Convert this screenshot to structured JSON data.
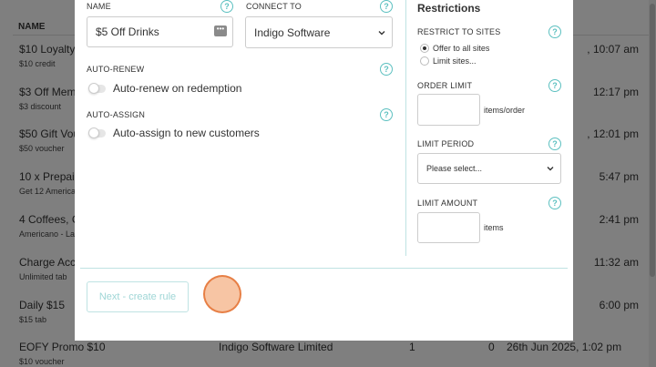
{
  "background": {
    "header_name": "NAME",
    "rows": [
      {
        "title": "$10 Loyalty",
        "sub": "$10 credit",
        "col_date": ", 10:07 am"
      },
      {
        "title": "$3 Off Mem",
        "sub": "$3 discount",
        "col_date": "12:17 pm"
      },
      {
        "title": "$50 Gift Vou",
        "sub": "$50 voucher",
        "col_date": ", 12:01 pm"
      },
      {
        "title": "10 x Prepaid",
        "sub": "Get 12 America",
        "col_date": "5:47 pm"
      },
      {
        "title": "4 Coffees, G",
        "sub": "Americano - La",
        "col_date": "2:41 pm"
      },
      {
        "title": "Charge Acco",
        "sub": "Unlimited tab",
        "col_date": "11:32 am"
      },
      {
        "title": "Daily $15",
        "sub": "$15 tab",
        "col_date": "6:00 pm"
      },
      {
        "title": "EOFY Promo $10",
        "sub": "$10 voucher",
        "company": "Indigo Software Limited",
        "count1": "1",
        "count2": "0",
        "date": "26th Jun 2025, 1:02 pm"
      }
    ]
  },
  "modal": {
    "name": {
      "label": "NAME",
      "value": "$5 Off Drinks",
      "help": "?"
    },
    "connect": {
      "label": "CONNECT TO",
      "value": "Indigo Software",
      "help": "?"
    },
    "auto_renew": {
      "label": "AUTO-RENEW",
      "toggle_label": "Auto-renew on redemption",
      "help": "?"
    },
    "auto_assign": {
      "label": "AUTO-ASSIGN",
      "toggle_label": "Auto-assign to new customers",
      "help": "?"
    },
    "restrictions": {
      "title": "Restrictions",
      "sites_label": "RESTRICT TO SITES",
      "sites_options": [
        "Offer to all sites",
        "Limit sites..."
      ],
      "order_limit_label": "ORDER LIMIT",
      "order_limit_unit": "items/order",
      "period_label": "LIMIT PERIOD",
      "period_placeholder": "Please select...",
      "amount_label": "LIMIT AMOUNT",
      "amount_unit": "items",
      "help": "?"
    },
    "next_button": "Next - create rule"
  },
  "colors": {
    "accent": "#5cc0c0",
    "overlay": "rgba(0,0,0,0.5)"
  }
}
